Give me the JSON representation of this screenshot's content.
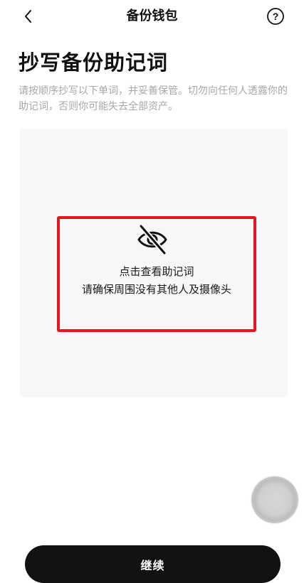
{
  "nav": {
    "title": "备份钱包",
    "back_icon": "chevron-left-icon",
    "help_icon": "question-circle-icon",
    "help_glyph": "?"
  },
  "main": {
    "title": "抄写备份助记词",
    "description": "请按顺序抄写以下单词，并妥善保管。切勿向任何人透露你的助记词，否则你可能失去全部资产。",
    "reveal": {
      "icon": "eye-off-icon",
      "line1": "点击查看助记词",
      "line2": "请确保周围没有其他人及摄像头"
    }
  },
  "footer": {
    "continue_label": "继续"
  },
  "colors": {
    "highlight_border": "#e5161d",
    "button_bg": "#121212",
    "panel_bg": "#f7f7f9",
    "description_text": "#a7a7aa"
  }
}
